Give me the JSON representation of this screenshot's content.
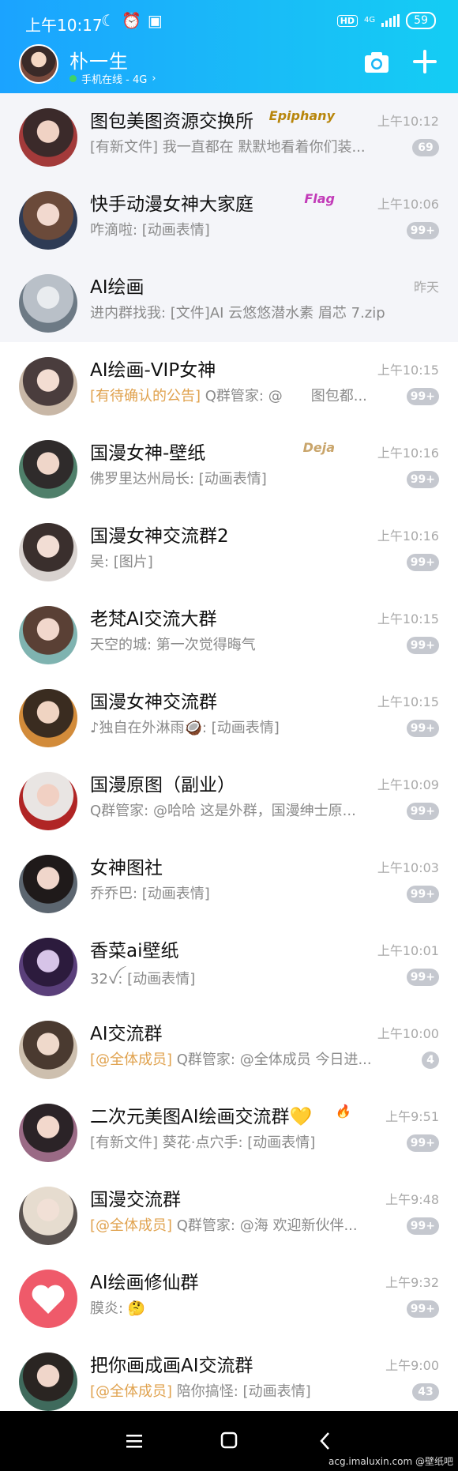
{
  "status": {
    "time": "上午10:17",
    "hd": "HD",
    "network": "4G",
    "battery": "59"
  },
  "header": {
    "nickname": "朴一生",
    "online_status": "手机在线 - 4G",
    "chevron": "›"
  },
  "chats": [
    {
      "title": "图包美图资源交换所",
      "tag": "",
      "preview": "[有新文件] 我一直都在 默默地看着你们装...",
      "time": "上午10:12",
      "badge": "69",
      "deco": "Epiphany",
      "deco_color": "#b8860b"
    },
    {
      "title": "快手动漫女神大家庭",
      "tag": "",
      "preview": "咋滴啦: [动画表情]",
      "time": "上午10:06",
      "badge": "99+",
      "deco": "Flag",
      "deco_color": "#c23bb8"
    },
    {
      "title": "AI绘画",
      "tag": "",
      "preview": "进内群找我: [文件]AI 云悠悠潜水素 眉芯 7.zip",
      "time": "昨天",
      "badge": "",
      "deco": "",
      "deco_color": ""
    },
    {
      "title": "AI绘画-VIP女神",
      "tag": "[有待确认的公告]",
      "preview": " Q群管家: @　　图包都...",
      "time": "上午10:15",
      "badge": "99+",
      "deco": "",
      "deco_color": ""
    },
    {
      "title": "国漫女神-壁纸",
      "tag": "",
      "preview": "佛罗里达州局长: [动画表情]",
      "time": "上午10:16",
      "badge": "99+",
      "deco": "Deja",
      "deco_color": "#c9a56b"
    },
    {
      "title": "国漫女神交流群2",
      "tag": "",
      "preview": "吴: [图片]",
      "time": "上午10:16",
      "badge": "99+",
      "deco": "",
      "deco_color": ""
    },
    {
      "title": "老梵AI交流大群",
      "tag": "",
      "preview": "天空的城: 第一次觉得晦气",
      "time": "上午10:15",
      "badge": "99+",
      "deco": "",
      "deco_color": ""
    },
    {
      "title": "国漫女神交流群",
      "tag": "",
      "preview": "♪独自在外淋雨🥥: [动画表情]",
      "time": "上午10:15",
      "badge": "99+",
      "deco": "",
      "deco_color": ""
    },
    {
      "title": "国漫原图（副业）",
      "tag": "",
      "preview": "Q群管家: @哈哈 这是外群，国漫绅士原...",
      "time": "上午10:09",
      "badge": "99+",
      "deco": "",
      "deco_color": ""
    },
    {
      "title": "女神图社",
      "tag": "",
      "preview": "乔乔巴: [动画表情]",
      "time": "上午10:03",
      "badge": "99+",
      "deco": "",
      "deco_color": ""
    },
    {
      "title": "香菜ai壁纸",
      "tag": "",
      "preview": "32ꪜ: [动画表情]",
      "time": "上午10:01",
      "badge": "99+",
      "deco": "",
      "deco_color": ""
    },
    {
      "title": "AI交流群",
      "tag": "[@全体成员]",
      "preview": " Q群管家: @全体成员 今日进...",
      "time": "上午10:00",
      "badge": "4",
      "deco": "",
      "deco_color": ""
    },
    {
      "title": "二次元美图AI绘画交流群💛",
      "tag": "",
      "preview": "[有新文件] 葵花·点穴手: [动画表情]",
      "time": "上午9:51",
      "badge": "99+",
      "deco": "🔥",
      "deco_color": "#ff6a00"
    },
    {
      "title": "国漫交流群",
      "tag": "[@全体成员]",
      "preview": " Q群管家: @海 欢迎新伙伴...",
      "time": "上午9:48",
      "badge": "99+",
      "deco": "",
      "deco_color": ""
    },
    {
      "title": "AI绘画修仙群",
      "tag": "",
      "preview": "膜炎: 🤔",
      "time": "上午9:32",
      "badge": "99+",
      "deco": "",
      "deco_color": ""
    },
    {
      "title": "把你画成画AI交流群",
      "tag": "[@全体成员]",
      "preview": " 陪你搞怪: [动画表情]",
      "time": "上午9:00",
      "badge": "43",
      "deco": "",
      "deco_color": ""
    }
  ],
  "avatars": [
    [
      "#f0d2c4",
      "#3b2a2a",
      "#a33a3a"
    ],
    [
      "#f2d9cf",
      "#6b4a3a",
      "#2e3b55"
    ],
    [
      "#e9ecef",
      "#b9c0c8",
      "#6d7a85"
    ],
    [
      "#f3ddd2",
      "#4a3d3d",
      "#c8b7a6"
    ],
    [
      "#efd6c9",
      "#2f2b2b",
      "#4f7f6a"
    ],
    [
      "#f2ddd4",
      "#3a2f2d",
      "#d8d2cf"
    ],
    [
      "#f1d7cc",
      "#5a4035",
      "#7fb3b0"
    ],
    [
      "#f0d4c2",
      "#3a2c20",
      "#d28b3a"
    ],
    [
      "#f1d0c3",
      "#e9e5e3",
      "#b02525"
    ],
    [
      "#f0d6cb",
      "#1f1a1a",
      "#5c6670"
    ],
    [
      "#d7c4e8",
      "#2c1b3d",
      "#5a3f7a"
    ],
    [
      "#efd9cb",
      "#4a3a30",
      "#cdbfae"
    ],
    [
      "#f2d8cc",
      "#2b2327",
      "#9a6a85"
    ],
    [
      "#f1e0d6",
      "#e6dccf",
      "#5a5350"
    ],
    [
      "#ef5a6a",
      "#ef5a6a",
      "#ef5a6a"
    ],
    [
      "#f0d6ca",
      "#2a2522",
      "#3f6a5c"
    ]
  ],
  "watermark": "acg.imaluxin.com  @壁纸吧"
}
